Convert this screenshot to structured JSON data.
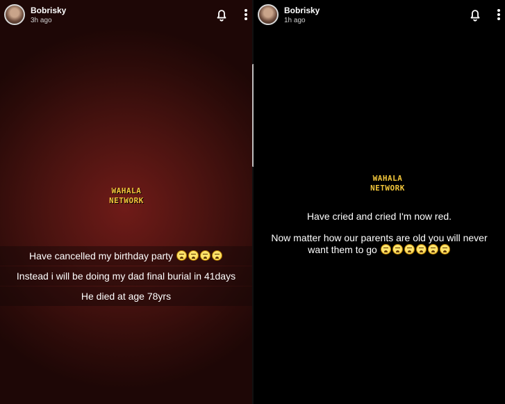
{
  "left_story": {
    "username": "Bobrisky",
    "time_ago": "3h ago",
    "watermark_line1": "WAHALA",
    "watermark_line2": "NETWORK",
    "caption_line1": "Have cancelled my birthday party",
    "caption_line2": "Instead i will be doing my dad final burial in 41days",
    "caption_line3": "He died at age 78yrs",
    "emoji_icon": "weary-face-icon",
    "emoji_count": 4
  },
  "right_story": {
    "username": "Bobrisky",
    "time_ago": "1h ago",
    "watermark_line1": "WAHALA",
    "watermark_line2": "NETWORK",
    "caption_line1": "Have cried and cried I'm now red.",
    "caption_line2a": "Now matter how our parents are old you will never",
    "caption_line2b": "want them to go",
    "emoji_icon": "weary-face-icon",
    "emoji_count": 6
  },
  "icons": {
    "notification": "bell-icon",
    "menu": "more-vertical-icon"
  },
  "colors": {
    "watermark": "#f2c63b",
    "left_background": "#4a1310",
    "right_background": "#000000"
  }
}
